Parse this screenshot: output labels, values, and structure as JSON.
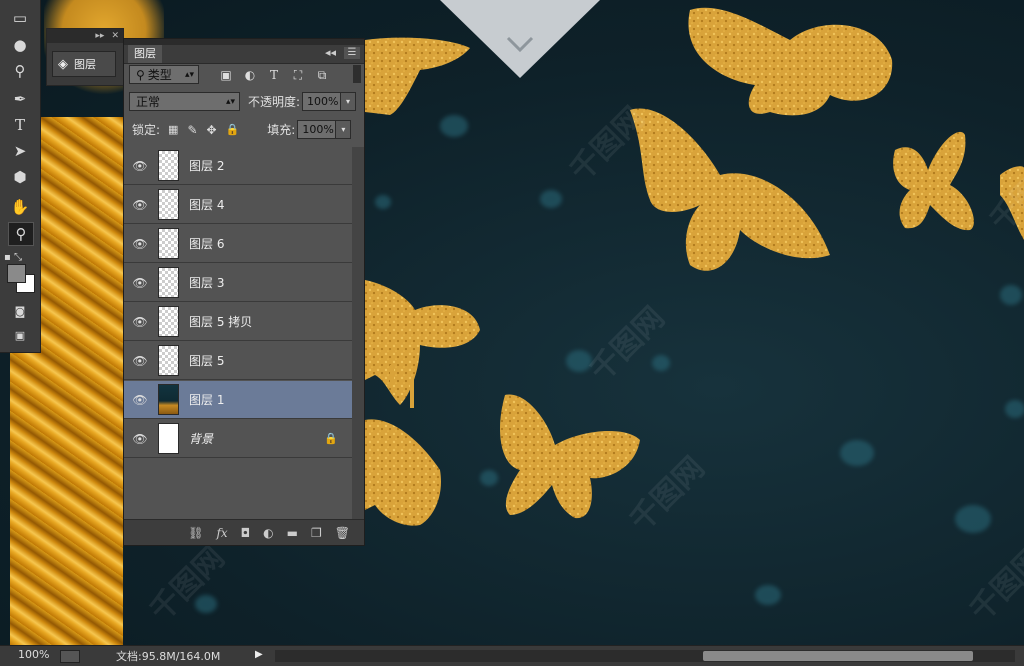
{
  "toolbar": {
    "tools": [
      {
        "name": "gradient-tool-icon",
        "glyph": "▭"
      },
      {
        "name": "blur-tool-icon",
        "glyph": "💧"
      },
      {
        "name": "dodge-tool-icon",
        "glyph": "🔍"
      },
      {
        "name": "pen-tool-icon",
        "glyph": "✒"
      },
      {
        "name": "type-tool-icon",
        "glyph": "T"
      },
      {
        "name": "path-selection-tool-icon",
        "glyph": "➤"
      },
      {
        "name": "shape-tool-icon",
        "glyph": "⬢"
      },
      {
        "name": "hand-tool-icon",
        "glyph": "✋"
      },
      {
        "name": "zoom-tool-icon",
        "glyph": "🔍"
      }
    ]
  },
  "mini_panel": {
    "label": "图层"
  },
  "layers_panel": {
    "tab_label": "图层",
    "filter_type": "类型",
    "blend_mode": "正常",
    "opacity_label": "不透明度:",
    "opacity_value": "100%",
    "lock_label": "锁定:",
    "fill_label": "填充:",
    "fill_value": "100%",
    "layers": [
      {
        "name": "图层 2",
        "thumb": "checker",
        "selected": false,
        "locked": false
      },
      {
        "name": "图层 4",
        "thumb": "checker",
        "selected": false,
        "locked": false
      },
      {
        "name": "图层 6",
        "thumb": "checker",
        "selected": false,
        "locked": false
      },
      {
        "name": "图层 3",
        "thumb": "checker",
        "selected": false,
        "locked": false
      },
      {
        "name": "图层 5 拷贝",
        "thumb": "checker",
        "selected": false,
        "locked": false
      },
      {
        "name": "图层 5",
        "thumb": "checker",
        "selected": false,
        "locked": false
      },
      {
        "name": "图层 1",
        "thumb": "photo",
        "selected": true,
        "locked": false
      },
      {
        "name": "背景",
        "thumb": "white",
        "selected": false,
        "locked": true
      }
    ],
    "bottom_icons": [
      "link-layers-icon",
      "fx-icon",
      "add-mask-icon",
      "adjustment-layer-icon",
      "new-group-icon",
      "new-layer-icon",
      "delete-layer-icon"
    ]
  },
  "status_bar": {
    "zoom": "100%",
    "doc_info": "文档:95.8M/164.0M"
  },
  "colors": {
    "panel_bg": "#535353",
    "selected_layer": "#6b7b98",
    "gold": "#d9a33a",
    "canvas": "#0f2530"
  }
}
